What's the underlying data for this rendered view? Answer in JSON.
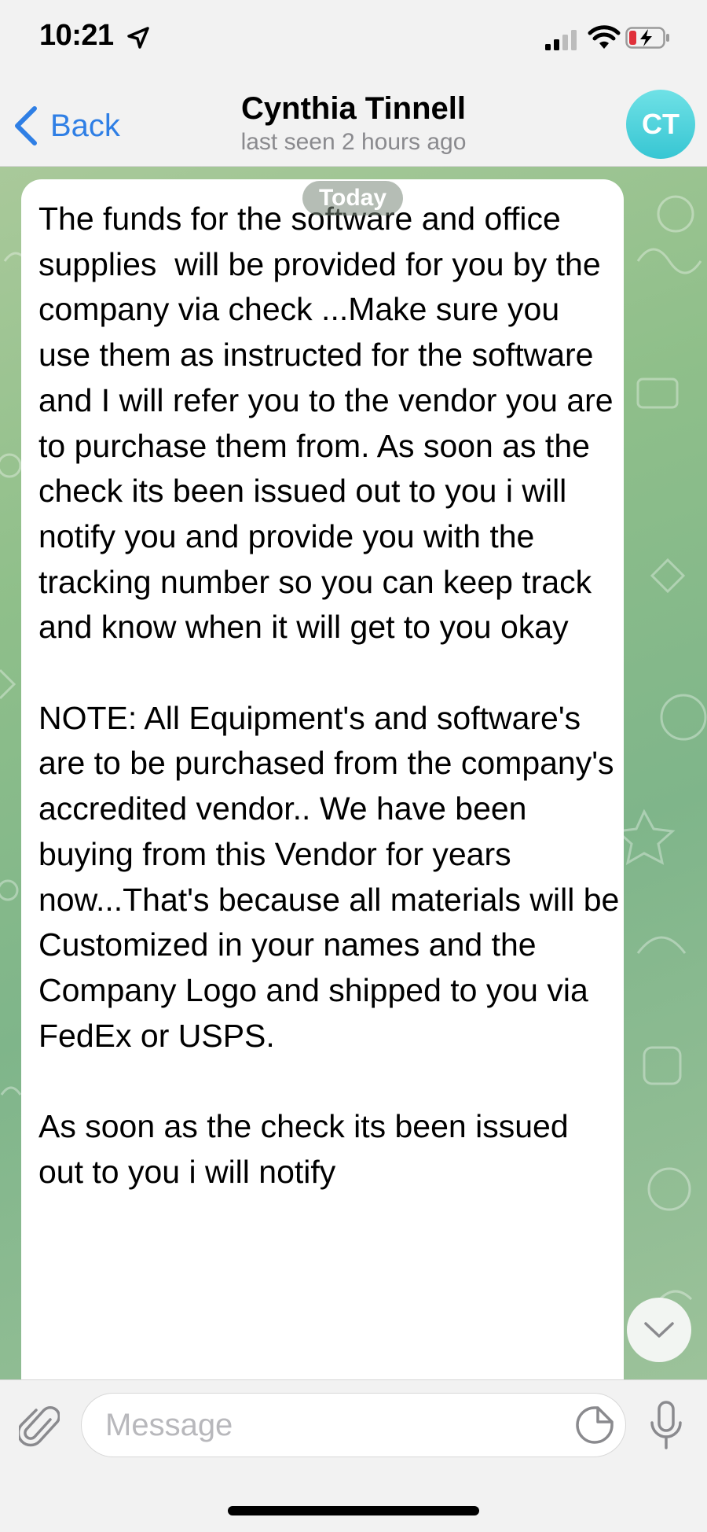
{
  "status_bar": {
    "time": "10:21"
  },
  "nav": {
    "back_label": "Back",
    "title": "Cynthia Tinnell",
    "subtitle": "last seen 2 hours ago",
    "avatar_initials": "CT"
  },
  "chat": {
    "date_label": "Today",
    "message_text": "The funds for the software and office supplies  will be provided for you by the company via check ...Make sure you use them as instructed for the software and I will refer you to the vendor you are to purchase them from. As soon as the check its been issued out to you i will notify you and provide you with the tracking number so you can keep track and know when it will get to you okay\n\nNOTE: All Equipment's and software's are to be purchased from the company's accredited vendor.. We have been buying from this Vendor for years now...That's because all materials will be Customized in your names and the Company Logo and shipped to you via FedEx or USPS.\n\nAs soon as the check its been issued out to you i will notify"
  },
  "input": {
    "placeholder": "Message"
  },
  "colors": {
    "accent": "#2f7fe5",
    "avatar": "#3fc8d4",
    "chat_bg": "#8fbf8a"
  }
}
